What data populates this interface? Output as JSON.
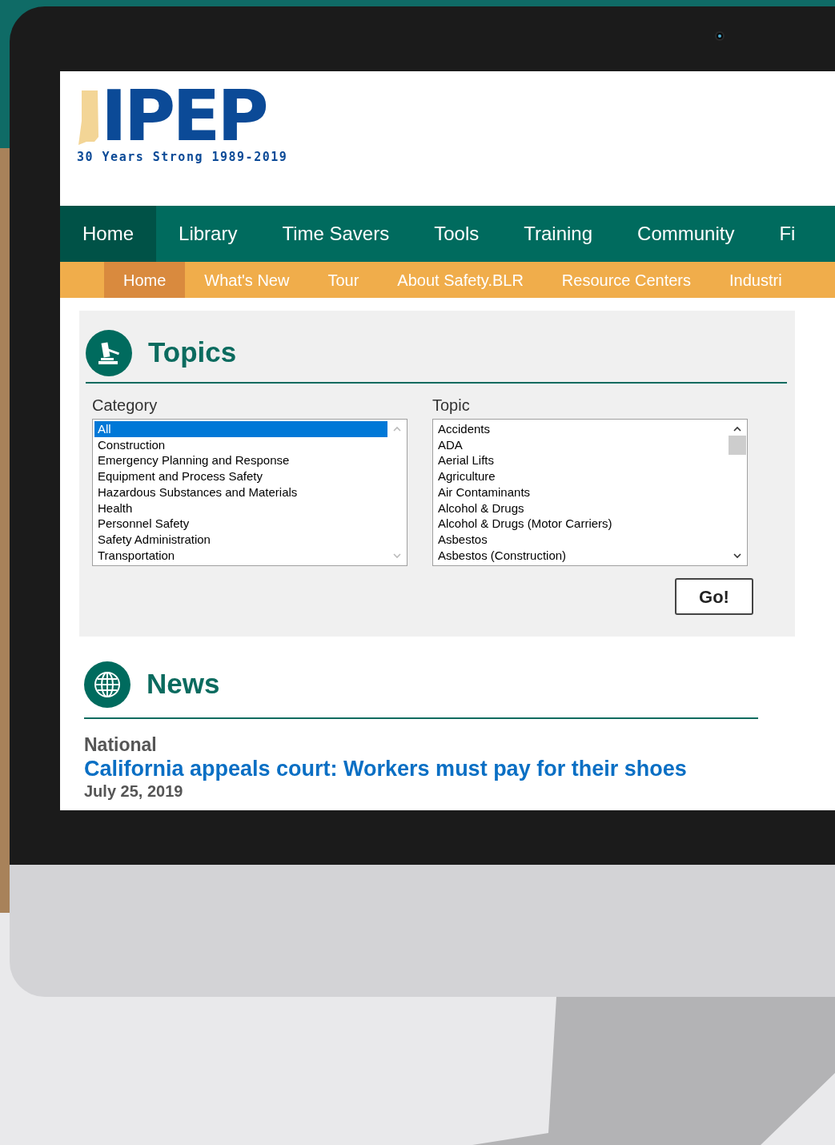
{
  "logo": {
    "text": "IPEP",
    "tagline": "30 Years Strong 1989-2019"
  },
  "main_nav": [
    {
      "label": "Home",
      "selected": true
    },
    {
      "label": "Library",
      "selected": false
    },
    {
      "label": "Time Savers",
      "selected": false
    },
    {
      "label": "Tools",
      "selected": false
    },
    {
      "label": "Training",
      "selected": false
    },
    {
      "label": "Community",
      "selected": false
    },
    {
      "label": "Fi",
      "selected": false
    }
  ],
  "sub_nav": [
    {
      "label": "Home",
      "selected": true
    },
    {
      "label": "What's New",
      "selected": false
    },
    {
      "label": "Tour",
      "selected": false
    },
    {
      "label": "About Safety.BLR",
      "selected": false
    },
    {
      "label": "Resource Centers",
      "selected": false
    },
    {
      "label": "Industri",
      "selected": false
    }
  ],
  "topics": {
    "title": "Topics",
    "category": {
      "label": "Category",
      "items": [
        {
          "label": "All",
          "selected": true
        },
        {
          "label": "Construction",
          "selected": false
        },
        {
          "label": "Emergency Planning and Response",
          "selected": false
        },
        {
          "label": "Equipment and Process Safety",
          "selected": false
        },
        {
          "label": "Hazardous Substances and Materials",
          "selected": false
        },
        {
          "label": "Health",
          "selected": false
        },
        {
          "label": "Personnel Safety",
          "selected": false
        },
        {
          "label": "Safety Administration",
          "selected": false
        },
        {
          "label": "Transportation",
          "selected": false
        }
      ]
    },
    "topic": {
      "label": "Topic",
      "items": [
        {
          "label": "Accidents",
          "selected": false
        },
        {
          "label": "ADA",
          "selected": false
        },
        {
          "label": "Aerial Lifts",
          "selected": false
        },
        {
          "label": "Agriculture",
          "selected": false
        },
        {
          "label": "Air Contaminants",
          "selected": false
        },
        {
          "label": "Alcohol & Drugs",
          "selected": false
        },
        {
          "label": "Alcohol & Drugs (Motor Carriers)",
          "selected": false
        },
        {
          "label": "Asbestos",
          "selected": false
        },
        {
          "label": "Asbestos (Construction)",
          "selected": false
        }
      ]
    },
    "button": "Go!"
  },
  "news": {
    "title": "News",
    "section": "National",
    "headline": "California appeals court: Workers must pay for their shoes",
    "date": "July 25, 2019"
  }
}
